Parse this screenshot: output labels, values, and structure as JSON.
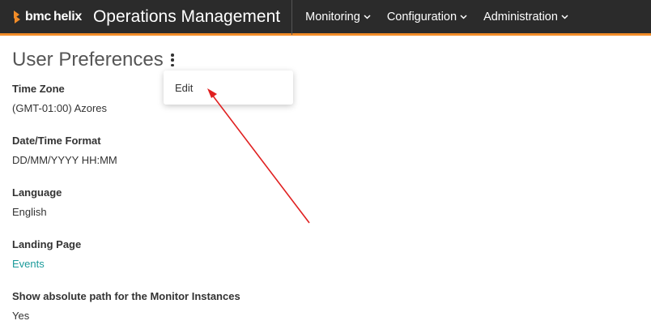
{
  "header": {
    "logo": {
      "bmc": "bmc",
      "helix": "helix"
    },
    "app_title": "Operations Management",
    "nav": [
      {
        "label": "Monitoring"
      },
      {
        "label": "Configuration"
      },
      {
        "label": "Administration"
      }
    ],
    "accent_color": "#f28c28"
  },
  "page": {
    "title": "User Preferences"
  },
  "menu": {
    "items": [
      {
        "label": "Edit"
      }
    ]
  },
  "fields": [
    {
      "label": "Time Zone",
      "value": "(GMT-01:00) Azores"
    },
    {
      "label": "Date/Time Format",
      "value": "DD/MM/YYYY HH:MM"
    },
    {
      "label": "Language",
      "value": "English"
    },
    {
      "label": "Landing Page",
      "value": "Events"
    },
    {
      "label": "Show absolute path for the Monitor Instances",
      "value": "Yes"
    }
  ],
  "annotation": {
    "arrow_color": "#e02020"
  }
}
